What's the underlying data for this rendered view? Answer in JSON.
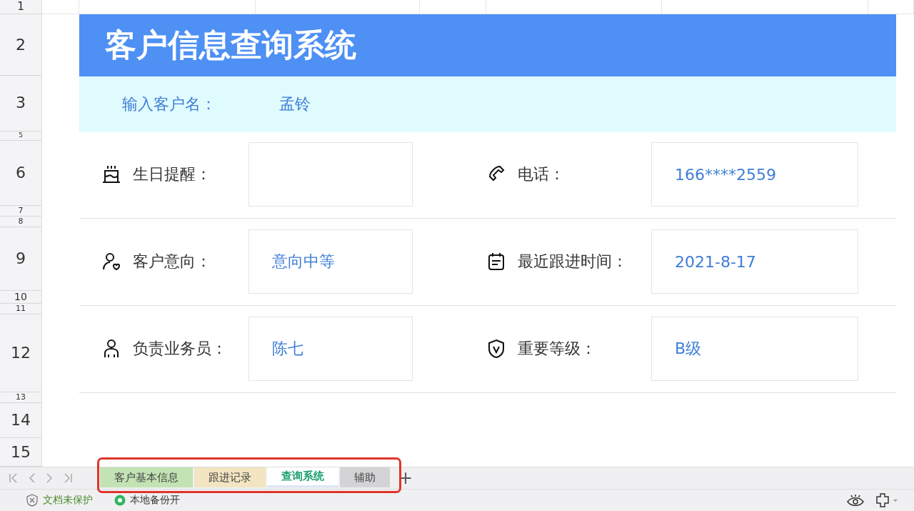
{
  "row_headers": [
    "1",
    "2",
    "3",
    "5",
    "6",
    "7",
    "8",
    "9",
    "10",
    "11",
    "12",
    "13",
    "14",
    "15"
  ],
  "title": "客户信息查询系统",
  "search": {
    "label": "输入客户名：",
    "value": "孟铃"
  },
  "field_rows": [
    {
      "items": [
        {
          "label": "生日提醒："
        },
        {
          "label": "电话：",
          "value": "166****2559"
        }
      ]
    },
    {
      "items": [
        {
          "label": "客户意向：",
          "value": "意向中等"
        },
        {
          "label": "最近跟进时间：",
          "value": "2021-8-17"
        }
      ]
    },
    {
      "items": [
        {
          "label": "负责业务员：",
          "value": "陈七"
        },
        {
          "label": "重要等级：",
          "value": "B级"
        }
      ]
    }
  ],
  "sheet_tabs": [
    {
      "label": "客户基本信息",
      "color": "#c3e3b4",
      "selected": false
    },
    {
      "label": "跟进记录",
      "color": "#f3e5c2",
      "selected": false
    },
    {
      "label": "查询系统",
      "color": "#ffffff",
      "selected": true
    },
    {
      "label": "辅助",
      "color": "#d4d4d6",
      "selected": false
    }
  ],
  "add_tab": "+",
  "status_bar": {
    "protection": "文档未保护",
    "backup": "本地备份开"
  }
}
